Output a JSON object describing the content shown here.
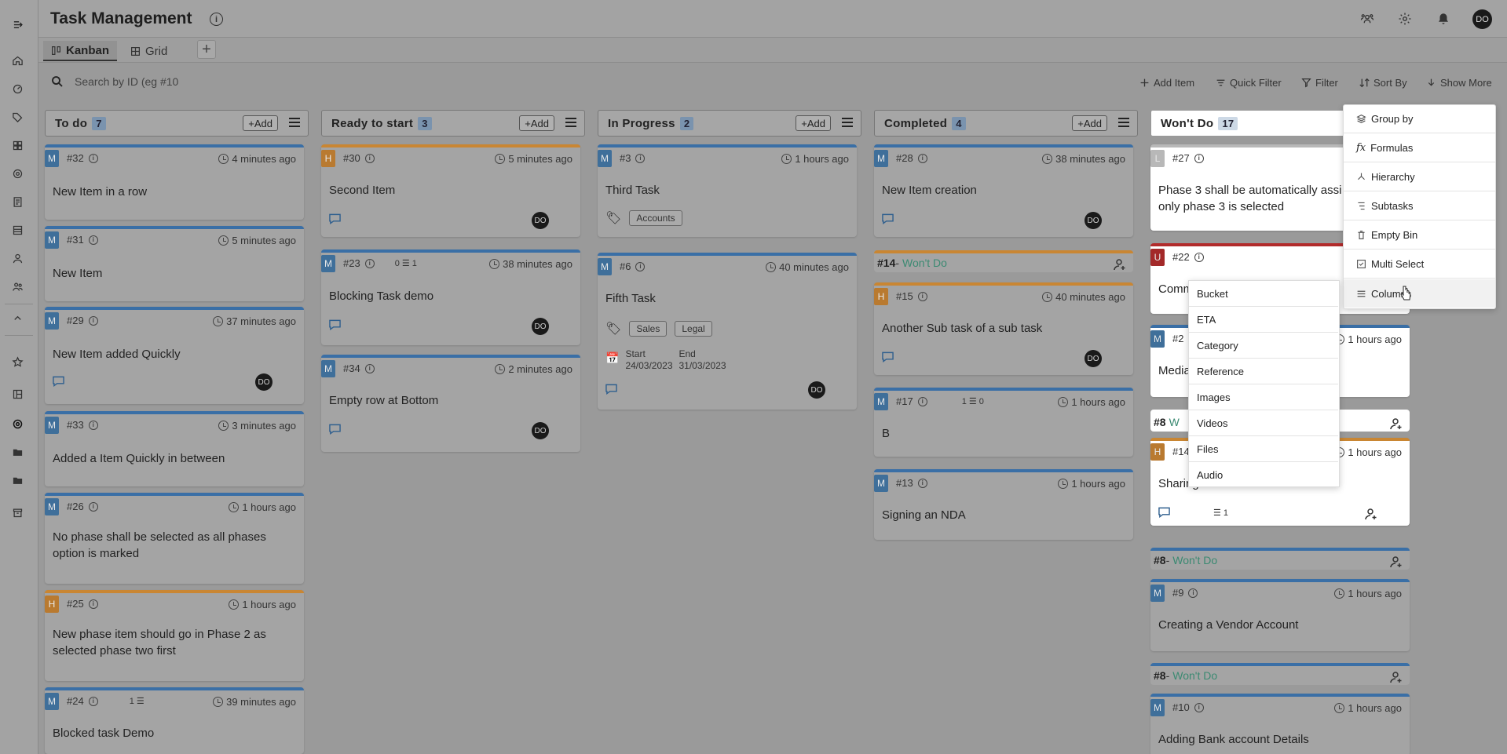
{
  "app": {
    "title": "Task Management",
    "user_initials": "DO"
  },
  "tabs": [
    {
      "label": "Kanban"
    },
    {
      "label": "Grid"
    }
  ],
  "toolbar": {
    "search_placeholder": "Search by ID (eg #10",
    "add_item": "Add Item",
    "quick_filter": "Quick Filter",
    "filter": "Filter",
    "sort_by": "Sort By",
    "show_more": "Show More"
  },
  "columns": [
    {
      "title": "To do",
      "count": "7",
      "add": "+Add"
    },
    {
      "title": "Ready to start",
      "count": "3",
      "add": "+Add"
    },
    {
      "title": "In Progress",
      "count": "2",
      "add": "+Add"
    },
    {
      "title": "Completed",
      "count": "4",
      "add": "+Add"
    },
    {
      "title": "Won't Do",
      "count": "17"
    }
  ],
  "todo": [
    {
      "badge": "M",
      "id": "#32",
      "time": "4 minutes ago",
      "title": "New Item in a row"
    },
    {
      "badge": "M",
      "id": "#31",
      "time": "5 minutes ago",
      "title": "New Item"
    },
    {
      "badge": "M",
      "id": "#29",
      "time": "37 minutes ago",
      "title": "New Item added Quickly",
      "avatar": "DO"
    },
    {
      "badge": "M",
      "id": "#33",
      "time": "3 minutes ago",
      "title": "Added a Item Quickly in between"
    },
    {
      "badge": "M",
      "id": "#26",
      "time": "1 hours ago",
      "title": "No phase shall be selected as all phases option is marked"
    },
    {
      "badge": "H",
      "id": "#25",
      "time": "1 hours ago",
      "title": "New phase item should go in Phase 2 as selected phase two first"
    },
    {
      "badge": "M",
      "id": "#24",
      "time": "39 minutes ago",
      "title": "Blocked task Demo",
      "sub": "1"
    }
  ],
  "ready": [
    {
      "badge": "H",
      "id": "#30",
      "time": "5 minutes ago",
      "title": "Second Item",
      "avatar": "DO"
    },
    {
      "badge": "M",
      "id": "#23",
      "time": "38 minutes ago",
      "title": "Blocking Task demo",
      "left": "0",
      "right": "1",
      "avatar": "DO"
    },
    {
      "badge": "M",
      "id": "#34",
      "time": "2 minutes ago",
      "title": "Empty row at Bottom",
      "avatar": "DO"
    }
  ],
  "progress": [
    {
      "badge": "M",
      "id": "#3",
      "time": "1 hours ago",
      "title": "Third Task",
      "tags": [
        "Accounts"
      ]
    },
    {
      "badge": "M",
      "id": "#6",
      "time": "40 minutes ago",
      "title": "Fifth Task",
      "tags": [
        "Sales",
        "Legal"
      ],
      "start_label": "Start",
      "start": "24/03/2023",
      "end_label": "End",
      "end": "31/03/2023",
      "avatar": "DO"
    }
  ],
  "completed": {
    "card28": {
      "badge": "M",
      "id": "#28",
      "time": "38 minutes ago",
      "title": "New Item creation",
      "avatar": "DO"
    },
    "group14": {
      "id": "#14",
      "sep": "- ",
      "status": "Won't Do"
    },
    "card15": {
      "badge": "H",
      "id": "#15",
      "time": "40 minutes ago",
      "title": "Another Sub task of a sub task",
      "avatar": "DO"
    },
    "card17": {
      "badge": "M",
      "id": "#17",
      "time": "1 hours ago",
      "title": "B",
      "left": "1",
      "right": "0"
    },
    "card13": {
      "badge": "M",
      "id": "#13",
      "time": "1 hours ago",
      "title": "Signing an NDA"
    }
  },
  "wontdo": {
    "card27": {
      "badge": "L",
      "id": "#27",
      "title": "Phase 3 shall be automatically assi only phase 3 is selected"
    },
    "card22": {
      "badge": "U",
      "id": "#22",
      "title": "Comm"
    },
    "card2x": {
      "badge": "M",
      "id": "#2",
      "time": "1 hours ago",
      "title": "Media"
    },
    "group8a": {
      "id": "#8",
      "status": "W"
    },
    "card14b": {
      "badge": "H",
      "id": "#14",
      "time": "1 hours ago",
      "title": "Sharing Brand Assets",
      "sub": "1"
    },
    "group8b": {
      "id": "#8",
      "sep": "- ",
      "status": "Won't Do"
    },
    "card9": {
      "badge": "M",
      "id": "#9",
      "time": "1 hours ago",
      "title": "Creating a Vendor Account"
    },
    "group8c": {
      "id": "#8",
      "sep": "- ",
      "status": "Won't Do"
    },
    "card10": {
      "badge": "M",
      "id": "#10",
      "time": "1 hours ago",
      "title": "Adding Bank account Details"
    }
  },
  "show_more_menu": [
    "Group by",
    "Formulas",
    "Hierarchy",
    "Subtasks",
    "Empty Bin",
    "Multi Select",
    "Columns"
  ],
  "columns_menu": [
    "Bucket",
    "ETA",
    "Category",
    "Reference",
    "Images",
    "Videos",
    "Files",
    "Audio"
  ]
}
